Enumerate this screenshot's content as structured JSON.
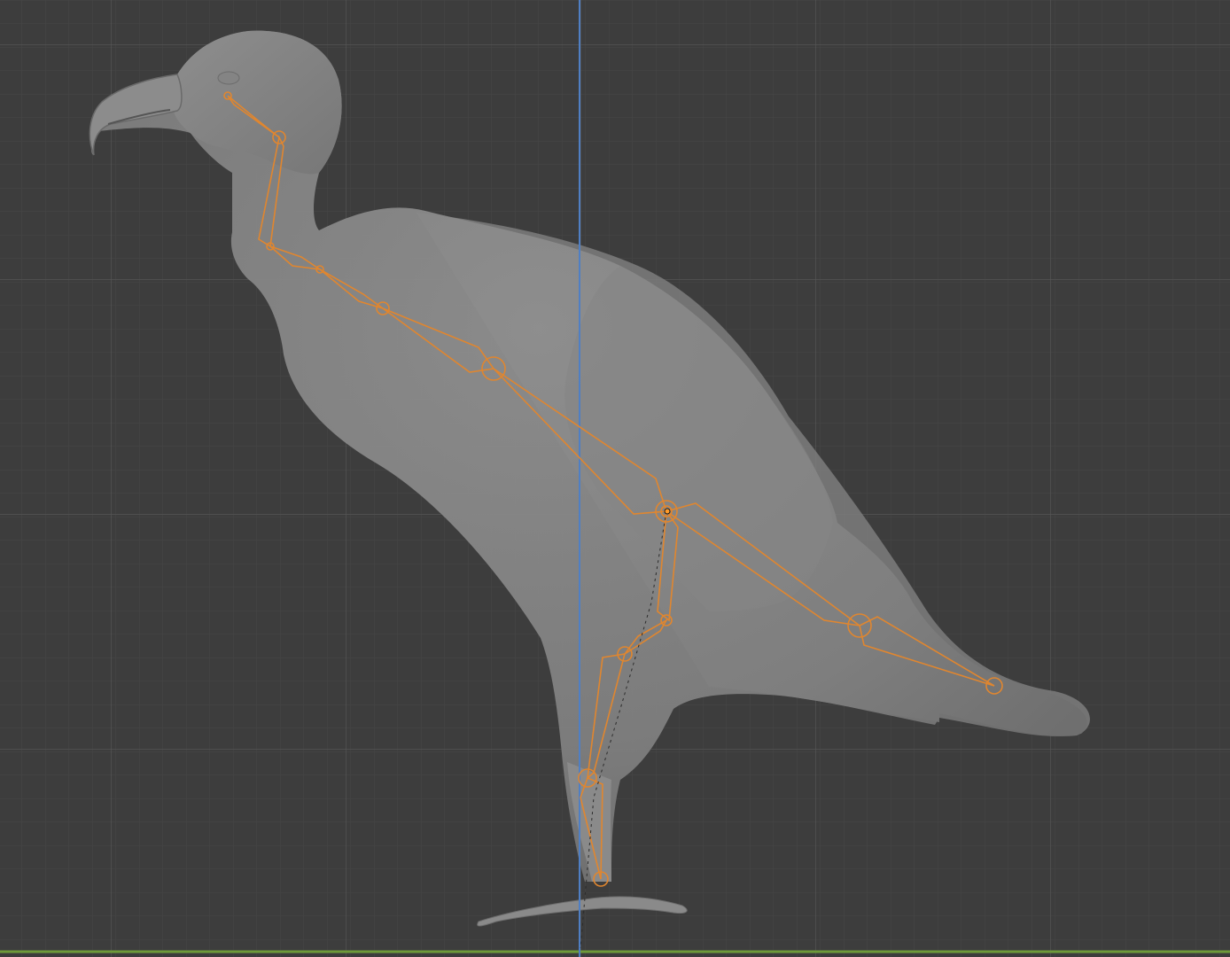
{
  "app": {
    "name": "",
    "view": "3d-viewport-side-orthographic"
  },
  "viewport": {
    "background_color": "#3d3d3d",
    "grid_minor_color": "#474747",
    "grid_major_color": "#555555",
    "axis_vertical_color": "#4f7fc4",
    "axis_horizontal_color": "#6e9a3a",
    "show_grid": true
  },
  "mesh": {
    "object": "vulture",
    "shading": "solid-xray",
    "color": "#8a8a8a"
  },
  "armature": {
    "color": "#e0862f",
    "display": "octahedral",
    "selected_joint": "hip-joint",
    "bones": [
      "head-bone",
      "neck-upper-bone",
      "neck-lower-bone",
      "spine-upper-bone",
      "spine-mid-bone",
      "spine-lower-bone",
      "tail-upper-bone",
      "tail-lower-bone",
      "thigh-bone",
      "shin-bone",
      "tarsus-bone",
      "foot-bone"
    ]
  }
}
